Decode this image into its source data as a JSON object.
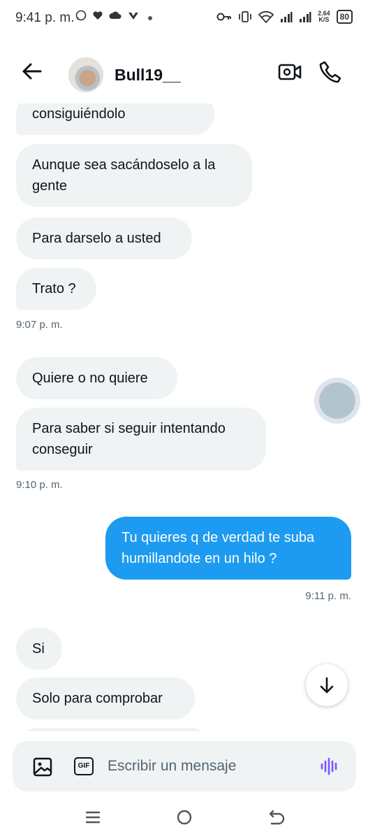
{
  "status_bar": {
    "time": "9:41 p. m.",
    "speed_value": "2.64",
    "speed_unit": "K/S",
    "battery": "80"
  },
  "header": {
    "username": "Bull19__"
  },
  "messages": [
    {
      "direction": "in",
      "text": "consiguiéndolo"
    },
    {
      "direction": "in",
      "text": "Aunque sea sacándoselo a la gente"
    },
    {
      "direction": "in",
      "text": "Para darselo a usted"
    },
    {
      "direction": "in",
      "text": "Trato ?"
    },
    {
      "direction": "in",
      "text": "Quiere o no quiere"
    },
    {
      "direction": "in",
      "text": "Para saber si seguir intentando conseguir"
    },
    {
      "direction": "out",
      "text": "Tu quieres q de verdad te suba humillandote en un hilo ?"
    },
    {
      "direction": "in",
      "text": "Si"
    },
    {
      "direction": "in",
      "text": "Solo para comprobar"
    }
  ],
  "timestamps": [
    "9:07 p. m.",
    "9:10 p. m.",
    "9:11 p. m."
  ],
  "composer": {
    "gif_label": "GIF",
    "placeholder": "Escribir un mensaje"
  },
  "colors": {
    "accent": "#1d9bf0",
    "incoming_bubble": "#eff3f4",
    "voice_icon": "#7856ff"
  },
  "icons": [
    "back-arrow-icon",
    "video-call-icon",
    "phone-icon",
    "image-icon",
    "gif-icon",
    "voice-message-icon",
    "arrow-down-icon",
    "menu-icon",
    "home-icon",
    "back-icon"
  ]
}
